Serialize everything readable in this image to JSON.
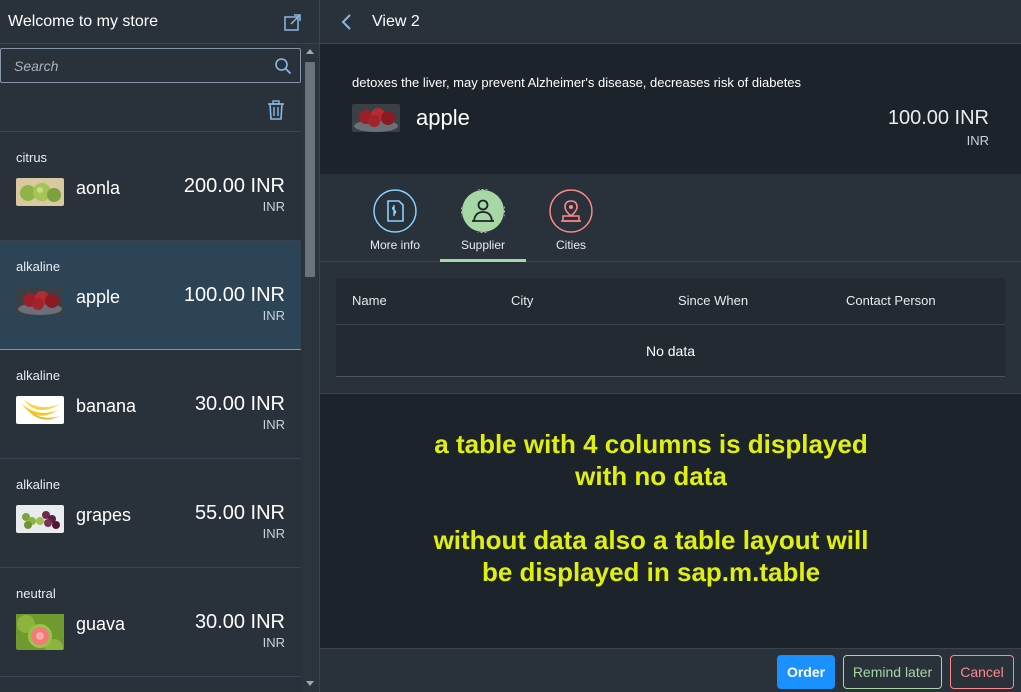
{
  "master": {
    "title": "Welcome to my store",
    "search_placeholder": "Search",
    "items": [
      {
        "group": "citrus",
        "name": "aonla",
        "price": "200.00 INR",
        "unit": "INR"
      },
      {
        "group": "alkaline",
        "name": "apple",
        "price": "100.00 INR",
        "unit": "INR"
      },
      {
        "group": "alkaline",
        "name": "banana",
        "price": "30.00 INR",
        "unit": "INR"
      },
      {
        "group": "alkaline",
        "name": "grapes",
        "price": "55.00 INR",
        "unit": "INR"
      },
      {
        "group": "neutral",
        "name": "guava",
        "price": "30.00 INR",
        "unit": "INR"
      }
    ],
    "selected_index": 1,
    "icons": [
      "share-icon",
      "search-icon",
      "delete-icon"
    ]
  },
  "detail": {
    "title": "View 2",
    "object": {
      "intro": "detoxes the liver, may prevent Alzheimer's disease, decreases risk of diabetes",
      "title": "apple",
      "price": "100.00 INR",
      "unit": "INR"
    },
    "tabs": [
      {
        "label": "More info",
        "icon": "document-icon",
        "color": "#89d1ff",
        "active": false
      },
      {
        "label": "Supplier",
        "icon": "supplier-icon",
        "color": "#a7d7a5",
        "active": true
      },
      {
        "label": "Cities",
        "icon": "location-icon",
        "color": "#ff8888",
        "active": false
      }
    ],
    "table": {
      "columns": [
        "Name",
        "City",
        "Since When",
        "Contact Person"
      ],
      "no_data": "No data"
    },
    "annotation": {
      "line1": "a table with 4 columns is displayed",
      "line2": "with no data",
      "line3": "without data also a table layout will",
      "line4": "be displayed in sap.m.table"
    },
    "footer": {
      "order": "Order",
      "remind": "Remind later",
      "cancel": "Cancel"
    }
  },
  "colors": {
    "accent": "#1b90ff",
    "positive": "#a7d7a5",
    "negative": "#ff8888",
    "annotation": "#e0f00e",
    "shell": "#29313a",
    "background": "#1d232a"
  }
}
